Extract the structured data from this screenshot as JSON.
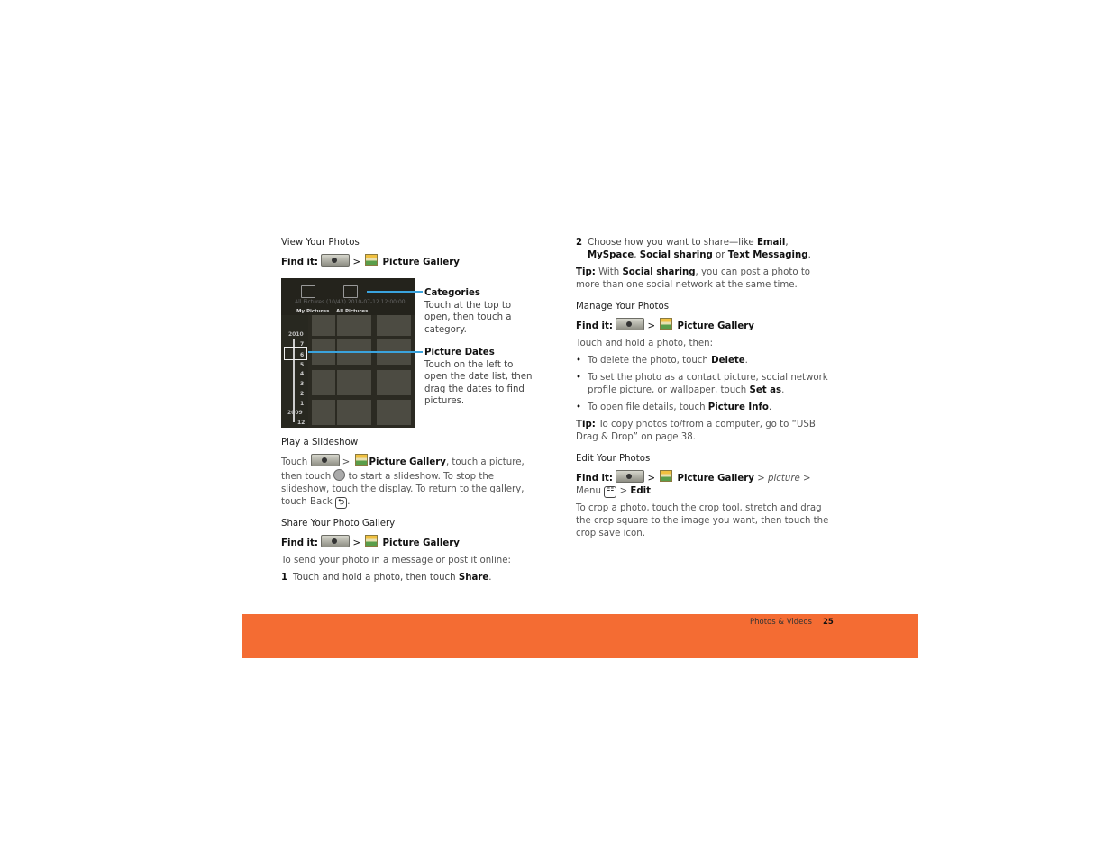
{
  "find_it_label": "Find it:",
  "picture_gallery": "Picture Gallery",
  "gt": ">",
  "left": {
    "view": {
      "heading": "View Your Photos",
      "screenshot": {
        "tab_my_pictures": "My Pictures",
        "tab_all_pictures": "All Pictures",
        "status_text": "All Pictures (10/43)   2010-07-12  12:00:00",
        "year_top": "2010",
        "months": [
          "7",
          "6",
          "5",
          "4",
          "3",
          "2",
          "1"
        ],
        "year_bottom": "2009",
        "month_bottom": "12"
      },
      "callouts": [
        {
          "title": "Categories",
          "text": "Touch at the top to open, then touch a category."
        },
        {
          "title": "Picture Dates",
          "text": "Touch on the left to open the date list, then drag the dates to find pictures."
        }
      ]
    },
    "slideshow": {
      "heading": "Play a Slideshow",
      "touch": "Touch",
      "after_gallery": ", touch a picture, then touch",
      "after_icon": "to start a slideshow. To stop the slideshow, touch the display. To return to the gallery, touch Back",
      "end": "."
    },
    "share": {
      "heading": "Share Your Photo Gallery",
      "intro": "To send your photo in a message or post it online:",
      "step1_num": "1",
      "step1_text": "Touch and hold a photo, then touch",
      "step1_bold": "Share",
      "step1_end": "."
    }
  },
  "right": {
    "step2": {
      "num": "2",
      "t1": "Choose how you want to share—like",
      "b1": "Email",
      "s1": ",",
      "b2": "MySpace",
      "s2": ",",
      "b3": "Social sharing",
      "t2": "or",
      "b4": "Text Messaging",
      "end": "."
    },
    "tip1": {
      "label": "Tip:",
      "t1": "With",
      "bold": "Social sharing",
      "t2": ", you can post a photo to more than one social network at the same time."
    },
    "manage": {
      "heading": "Manage Your Photos",
      "intro": "Touch and hold a photo, then:",
      "bullets": [
        {
          "text": "To delete the photo, touch",
          "bold": "Delete",
          "end": "."
        },
        {
          "text": "To set the photo as a contact picture, social network profile picture, or wallpaper, touch",
          "bold": "Set as",
          "end": "."
        },
        {
          "text": "To open file details, touch",
          "bold": "Picture Info",
          "end": "."
        }
      ]
    },
    "tip2": {
      "label": "Tip:",
      "text": "To copy photos to/from a computer, go to “USB Drag & Drop” on page 38."
    },
    "edit": {
      "heading": "Edit Your Photos",
      "picture": "picture",
      "menu": "Menu",
      "edit": "Edit",
      "body": "To crop a photo, touch the crop tool, stretch and drag the crop square to the image you want, then touch the crop save icon."
    }
  },
  "footer": {
    "section": "Photos & Videos",
    "page": "25",
    "band_color": "#f46c33"
  }
}
